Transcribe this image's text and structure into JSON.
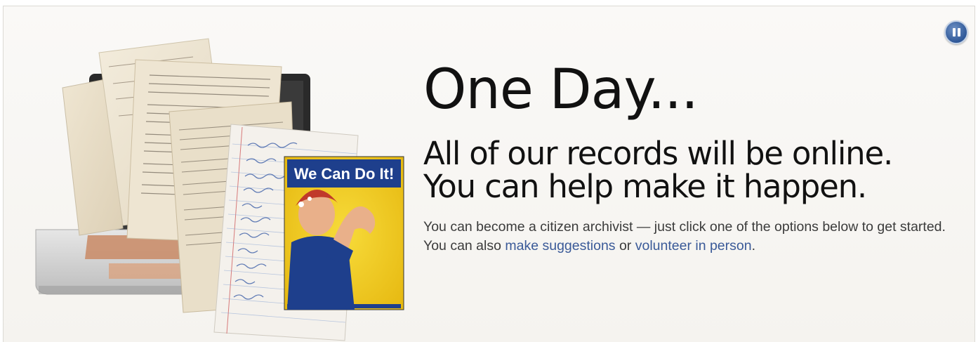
{
  "banner": {
    "headline": "One Day...",
    "subline1": "All of our records will be online.",
    "subline2": "You can help make it happen.",
    "body_part1": "You can become a citizen archivist — just click one of the options below to get started. You can also ",
    "link_suggestions": "make suggestions",
    "body_part2": " or ",
    "link_volunteer": "volunteer in person",
    "body_part3": "."
  },
  "poster": {
    "title": "We Can Do It!"
  },
  "controls": {
    "pause_icon": "pause-icon"
  },
  "colors": {
    "link": "#3a5a98",
    "pause_button": "#2f5898",
    "poster_yellow": "#f2cd1e",
    "poster_blue": "#1e3f8c"
  }
}
